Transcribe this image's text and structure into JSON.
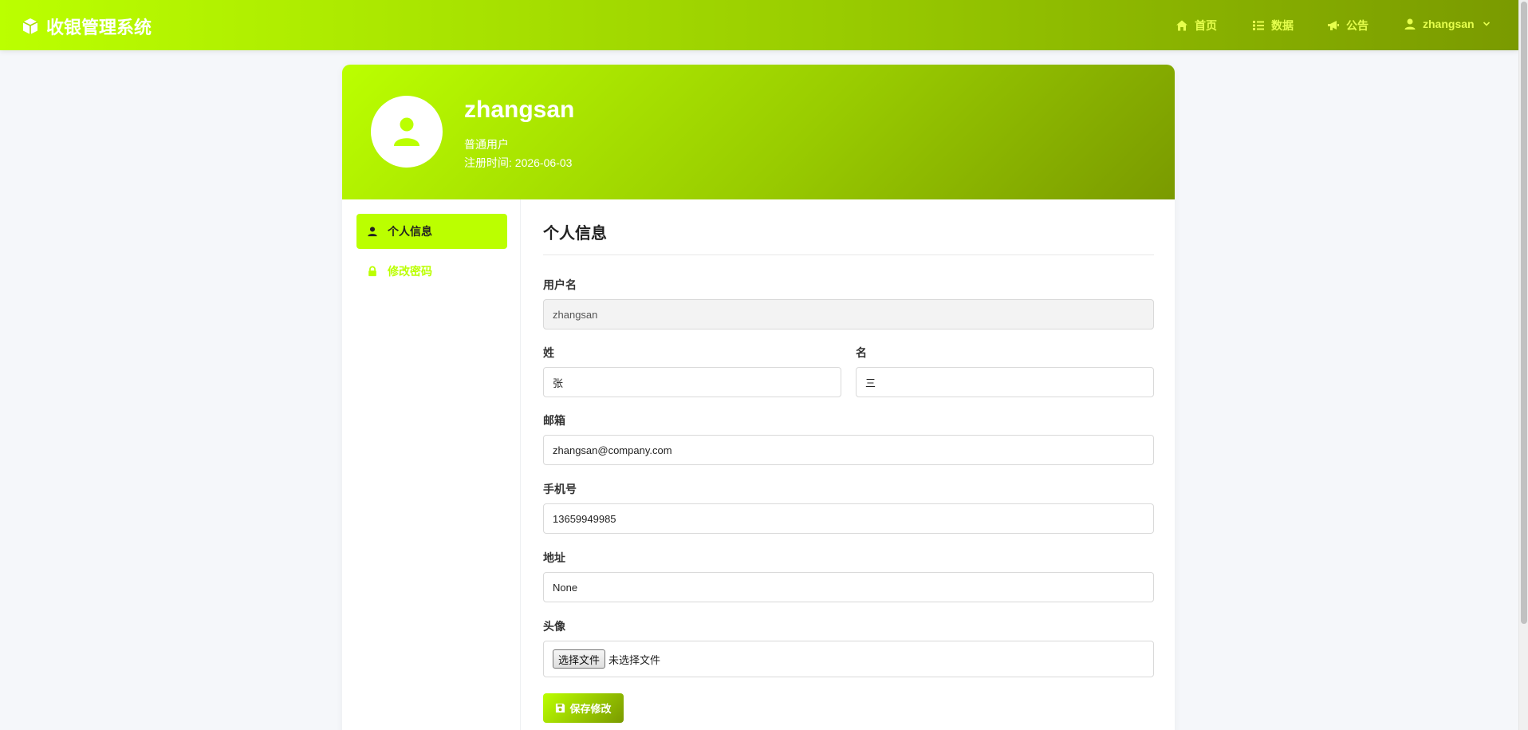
{
  "app": {
    "title": "收银管理系统",
    "brand_icon": "cube-icon"
  },
  "colors": {
    "accent": "#bbff00",
    "accent_dark": "#7a9a00",
    "nav_text": "#e6ff4d"
  },
  "nav": {
    "items": [
      {
        "label": "首页",
        "icon": "home-icon"
      },
      {
        "label": "数据",
        "icon": "list-icon"
      },
      {
        "label": "公告",
        "icon": "megaphone-icon"
      }
    ],
    "user": {
      "label": "zhangsan",
      "icon": "user-icon",
      "caret": "chevron-down-icon"
    }
  },
  "profile": {
    "name": "zhangsan",
    "role": "普通用户",
    "registered": "注册时间: 2026-06-03",
    "avatar_icon": "user-icon"
  },
  "sidebar": {
    "items": [
      {
        "label": "个人信息",
        "icon": "user-icon",
        "active": true
      },
      {
        "label": "修改密码",
        "icon": "lock-icon",
        "active": false
      }
    ]
  },
  "form": {
    "title": "个人信息",
    "username": {
      "label": "用户名",
      "value": "zhangsan"
    },
    "last_name": {
      "label": "姓",
      "value": "张"
    },
    "first_name": {
      "label": "名",
      "value": "三"
    },
    "email": {
      "label": "邮箱",
      "value": "zhangsan@company.com"
    },
    "phone": {
      "label": "手机号",
      "value": "13659949985"
    },
    "address": {
      "label": "地址",
      "value": "None"
    },
    "avatar": {
      "label": "头像",
      "button": "选择文件",
      "status": "未选择文件"
    },
    "save_label": "保存修改",
    "save_icon": "save-icon"
  }
}
